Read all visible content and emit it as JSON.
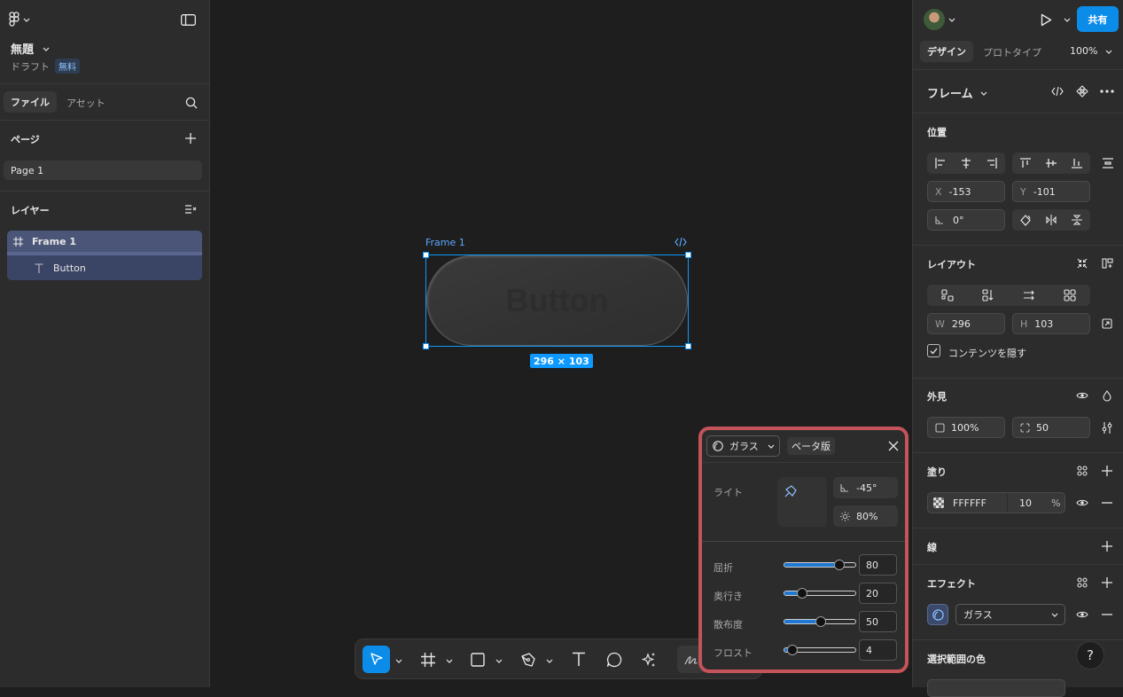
{
  "left_panel": {
    "file_name": "無題",
    "draft_label": "ドラフト",
    "plan_badge": "無料",
    "tabs": [
      "ファイル",
      "アセット"
    ],
    "pages_heading": "ページ",
    "pages": [
      "Page 1"
    ],
    "layers_heading": "レイヤー",
    "layers": [
      {
        "name": "Frame 1",
        "icon": "frame-hash-icon"
      },
      {
        "name": "Button",
        "icon": "text-t-icon"
      }
    ]
  },
  "canvas": {
    "frame_label": "Frame 1",
    "button_text": "Button",
    "size_badge": "296 × 103"
  },
  "right_panel": {
    "share_button": "共有",
    "tabs": [
      "デザイン",
      "プロトタイプ"
    ],
    "zoom": "100%",
    "selection_type": "フレーム",
    "position": {
      "heading": "位置",
      "x_label": "X",
      "x": "-153",
      "y_label": "Y",
      "y": "-101",
      "rotation": "0°"
    },
    "layout": {
      "heading": "レイアウト",
      "w_label": "W",
      "w": "296",
      "h_label": "H",
      "h": "103",
      "clip_content_label": "コンテンツを隠す",
      "clip_content": true
    },
    "appearance": {
      "heading": "外見",
      "opacity": "100%",
      "corner_radius": "50"
    },
    "fill": {
      "heading": "塗り",
      "hex": "FFFFFF",
      "opacity": "10",
      "unit": "%"
    },
    "stroke": {
      "heading": "線"
    },
    "effects": {
      "heading": "エフェクト",
      "effect_name": "ガラス"
    },
    "selection_colors": {
      "heading": "選択範囲の色"
    },
    "help": "?"
  },
  "glass_popup": {
    "type_select": "ガラス",
    "beta_badge": "ベータ版",
    "light_label": "ライト",
    "light_angle": "-45°",
    "light_intensity": "80%",
    "sliders": [
      {
        "label": "屈折",
        "value": "80",
        "level": 0.8
      },
      {
        "label": "奥行き",
        "value": "20",
        "level": 0.2
      },
      {
        "label": "散布度",
        "value": "50",
        "level": 0.5
      },
      {
        "label": "フロスト",
        "value": "4",
        "level": 0.04
      }
    ]
  },
  "colors": {
    "accent": "#0d99ff",
    "share_button": "#0c8ce9",
    "popup_highlight": "#c4535a",
    "slider_fill": "#1f78d1"
  }
}
